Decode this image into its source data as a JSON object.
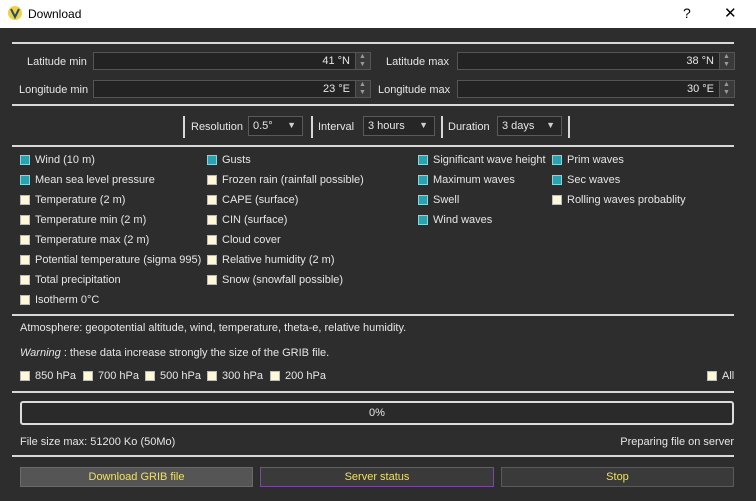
{
  "window": {
    "title": "Download",
    "help": "?",
    "close": "✕"
  },
  "coords": {
    "lat_min_label": "Latitude min",
    "lat_min_value": "41 °N",
    "lat_max_label": "Latitude max",
    "lat_max_value": "38 °N",
    "lon_min_label": "Longitude min",
    "lon_min_value": "23 °E",
    "lon_max_label": "Longitude max",
    "lon_max_value": "30 °E"
  },
  "options": {
    "resolution_label": "Resolution",
    "resolution_value": "0.5°",
    "interval_label": "Interval",
    "interval_value": "3 hours",
    "duration_label": "Duration",
    "duration_value": "3 days"
  },
  "params": {
    "col1": [
      {
        "label": "Wind (10 m)",
        "checked": true
      },
      {
        "label": "Mean sea level pressure",
        "checked": true
      },
      {
        "label": "Temperature (2 m)",
        "checked": false
      },
      {
        "label": "Temperature min (2 m)",
        "checked": false
      },
      {
        "label": "Temperature max (2 m)",
        "checked": false
      },
      {
        "label": "Potential temperature (sigma 995)",
        "checked": false
      },
      {
        "label": "Total precipitation",
        "checked": false
      },
      {
        "label": "Isotherm 0°C",
        "checked": false
      }
    ],
    "col2": [
      {
        "label": "Gusts",
        "checked": true
      },
      {
        "label": "Frozen rain (rainfall possible)",
        "checked": false
      },
      {
        "label": "CAPE (surface)",
        "checked": false
      },
      {
        "label": "CIN (surface)",
        "checked": false
      },
      {
        "label": "Cloud cover",
        "checked": false
      },
      {
        "label": "Relative humidity (2 m)",
        "checked": false
      },
      {
        "label": "Snow (snowfall possible)",
        "checked": false
      }
    ],
    "col3": [
      {
        "label": "Significant wave height",
        "checked": true
      },
      {
        "label": "Maximum waves",
        "checked": true
      },
      {
        "label": "Swell",
        "checked": true
      },
      {
        "label": "Wind waves",
        "checked": true
      }
    ],
    "col4": [
      {
        "label": "Prim waves",
        "checked": true
      },
      {
        "label": "Sec waves",
        "checked": true
      },
      {
        "label": "Rolling waves probablity",
        "checked": false
      }
    ]
  },
  "atmosphere": {
    "text": "Atmosphere: geopotential altitude, wind, temperature, theta-e, relative humidity.",
    "warning_word": "Warning",
    "warning_text": " : these data increase strongly the size of the GRIB file.",
    "levels": [
      "850 hPa",
      "700 hPa",
      "500 hPa",
      "300 hPa",
      "200 hPa"
    ],
    "all_label": "All"
  },
  "progress": {
    "value": 0,
    "text": "0%"
  },
  "status": {
    "file_size": "File size max: 51200 Ko (50Mo)",
    "server_msg": "Preparing file on server"
  },
  "buttons": {
    "download": "Download GRIB file",
    "server_status": "Server status",
    "stop": "Stop"
  },
  "colors": {
    "checked": "#2aa3b1",
    "unchecked": "#fff8d8",
    "button_text": "#f0e060"
  }
}
